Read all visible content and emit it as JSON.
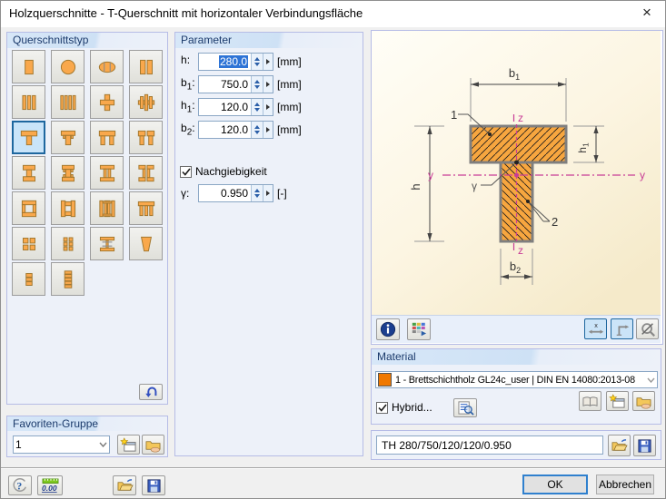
{
  "window": {
    "title": "Holzquerschnitte - T-Querschnitt mit horizontaler Verbindungsfläche",
    "close_glyph": "×"
  },
  "section_types": {
    "title": "Querschnittstyp",
    "selected_index": 8,
    "icons": [
      "rectangle-section",
      "circle-section",
      "segmented-ellipse-section",
      "double-rectangle-section",
      "triple-plank-section",
      "quad-plank-section",
      "plus-section",
      "plus-multi-plank-section",
      "t-section",
      "t-section-composite",
      "u-section",
      "u-section-split",
      "i-section",
      "i-section-composite",
      "double-web-i-section",
      "double-web-i-split-section",
      "box-horizontal-plank-section",
      "box-vertical-plank-section",
      "box-multi-vertical-section",
      "box-top-flange-section",
      "four-block-section",
      "six-block-section",
      "lattice-section",
      "v-section",
      "stacked-plank-short-section",
      "stacked-plank-tall-section"
    ],
    "undo_icon": "undo-icon"
  },
  "parameter": {
    "title": "Parameter",
    "fields": [
      {
        "label": "h",
        "sub": "",
        "value": "280.0",
        "unit": "[mm]"
      },
      {
        "label": "b",
        "sub": "1",
        "value": "750.0",
        "unit": "[mm]"
      },
      {
        "label": "h",
        "sub": "1",
        "value": "120.0",
        "unit": "[mm]"
      },
      {
        "label": "b",
        "sub": "2",
        "value": "120.0",
        "unit": "[mm]"
      }
    ],
    "nachgiebigkeit_label": "Nachgiebigkeit",
    "gamma": {
      "label": "γ:",
      "value": "0.950",
      "unit": "[-]"
    }
  },
  "drawing": {
    "labels": {
      "b_base": "b",
      "b1_sub": "1",
      "h": "h",
      "h1_base": "h",
      "h1_sub": "1",
      "b2_base": "b",
      "b2_sub": "2",
      "y_left": "y",
      "y_right": "y",
      "z_top": "z",
      "z_bottom": "z",
      "gamma": "γ",
      "part1": "1",
      "part2": "2"
    },
    "colors": {
      "section_fill": "#F7A63F",
      "section_border": "#7F7F7F",
      "axis": "#C83C96",
      "background": "#FBF4DF"
    }
  },
  "material": {
    "title": "Material",
    "selected": "1 - Brettschichtholz GL24c_user | DIN EN 14080:2013-08",
    "swatch_color": "#F07800",
    "hybrid_label": "Hybrid..."
  },
  "section_name": {
    "value": "TH 280/750/120/120/0.950"
  },
  "favorites": {
    "title": "Favoriten-Gruppe",
    "value": "1"
  },
  "actions": {
    "ok": "OK",
    "cancel": "Abbrechen"
  }
}
